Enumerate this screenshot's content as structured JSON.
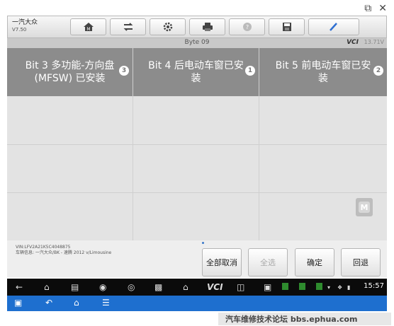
{
  "window": {
    "restore_icon": "restore-icon",
    "close_icon": "close-icon"
  },
  "header": {
    "brand": "一汽大众",
    "version": "V7.50",
    "toolbar": [
      {
        "name": "home-icon"
      },
      {
        "name": "vehicle-swap-icon"
      },
      {
        "name": "settings-icon"
      },
      {
        "name": "print-icon"
      },
      {
        "name": "help-icon"
      },
      {
        "name": "save-icon"
      },
      {
        "name": "edit-icon"
      }
    ]
  },
  "bytebar": {
    "byte": "Byte 09",
    "vci": "VCI",
    "battery": "13.71V"
  },
  "columns": [
    {
      "title": "Bit 3 多功能-方向盘 (MFSW) 已安装",
      "badge": "3"
    },
    {
      "title": "Bit 4 后电动车窗已安装",
      "badge": "1"
    },
    {
      "title": "Bit 5 前电动车窗已安装",
      "badge": "2"
    }
  ],
  "floating": {
    "label": "M"
  },
  "footer": {
    "vin": "VIN:LFV2A21K5C4048875",
    "vehicle_info": "车辆信息: 一汽大众/BK - 速腾 2012 v/Limousine",
    "buttons": {
      "deselect_all": "全部取消",
      "select_all": "全选",
      "confirm": "确定",
      "back": "回退"
    }
  },
  "statusbar": {
    "time": "15:57"
  },
  "watermark": "汽车维修技术论坛 bbs.ephua.com"
}
